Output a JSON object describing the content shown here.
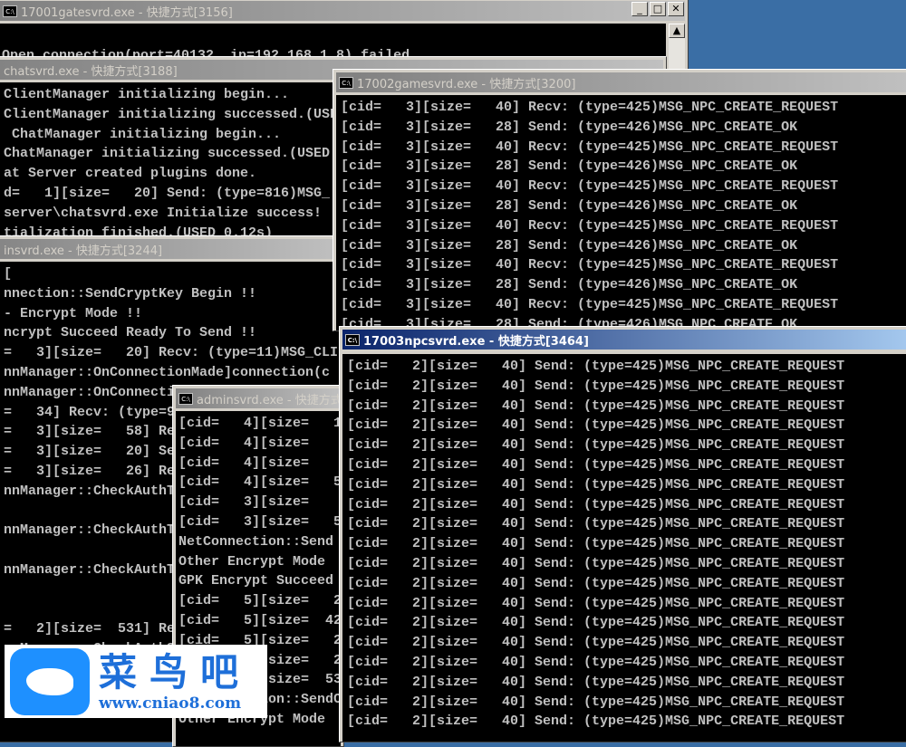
{
  "windows": {
    "gate": {
      "title": "17001gatesvrd.exe - 快捷方式[3156]",
      "lines": [
        "",
        "Open connection(port=40132, ip=192.168.1.8) failed"
      ]
    },
    "chat": {
      "title": "chatsvrd.exe - 快捷方式[3188]",
      "lines": [
        "ClientManager initializing begin...",
        "ClientManager initializing successed.(USED",
        " ChatManager initializing begin...",
        "ChatManager initializing successed.(USED",
        "at Server created plugins done.",
        "d=   1][size=   20] Send: (type=816)MSG_",
        "server\\chatsvrd.exe Initialize success!",
        "tialization finished.(USED 0.12s)"
      ]
    },
    "adminBig": {
      "title": "insvrd.exe - 快捷方式[3244]",
      "lines": [
        "[",
        "nnection::SendCryptKey Begin !!",
        "- Encrypt Mode !!",
        "ncrypt Succeed Ready To Send !!",
        "=   3][size=   20] Recv: (type=11)MSG_CLI",
        "nnManager::OnConnectionMade]connection(c",
        "nnManager::OnConnecti",
        "=   34] Recv: (type=9",
        "=   3][size=   58] Rec",
        "=   3][size=   20] Sen",
        "=   3][size=   26] Rec",
        "nnManager::CheckAuthT",
        "",
        "nnManager::CheckAuthT",
        "",
        "nnManager::CheckAuthT",
        "",
        "",
        "=   2][size=  531] Rec",
        "nnManager::CheckAuthS"
      ]
    },
    "game": {
      "title": "17002gamesvrd.exe - 快捷方式[3200]",
      "lines": [
        "[cid=   3][size=   40] Recv: (type=425)MSG_NPC_CREATE_REQUEST",
        "[cid=   3][size=   28] Send: (type=426)MSG_NPC_CREATE_OK",
        "[cid=   3][size=   40] Recv: (type=425)MSG_NPC_CREATE_REQUEST",
        "[cid=   3][size=   28] Send: (type=426)MSG_NPC_CREATE_OK",
        "[cid=   3][size=   40] Recv: (type=425)MSG_NPC_CREATE_REQUEST",
        "[cid=   3][size=   28] Send: (type=426)MSG_NPC_CREATE_OK",
        "[cid=   3][size=   40] Recv: (type=425)MSG_NPC_CREATE_REQUEST",
        "[cid=   3][size=   28] Send: (type=426)MSG_NPC_CREATE_OK",
        "[cid=   3][size=   40] Recv: (type=425)MSG_NPC_CREATE_REQUEST",
        "[cid=   3][size=   28] Send: (type=426)MSG_NPC_CREATE_OK",
        "[cid=   3][size=   40] Recv: (type=425)MSG_NPC_CREATE_REQUEST",
        "[cid=   3][size=   28] Send: (type=426)MSG_NPC_CREATE_OK"
      ]
    },
    "adminSmall": {
      "title": "adminsvrd.exe - 快捷方式",
      "lines": [
        "[cid=   4][size=   1",
        "[cid=   4][size=",
        "[cid=   4][size=",
        "[cid=   4][size=   5",
        "[cid=   3][size=",
        "[cid=   3][size=   5",
        "NetConnection::Send",
        "Other Encrypt Mode",
        "GPK Encrypt Succeed",
        "[cid=   5][size=   2",
        "[cid=   5][size=  42",
        "[cid=   5][size=   2",
        "[cid=   5][size=   2",
        "[cid=   5][size=  53",
        "NetConnection::SendC",
        "Other Encrypt Mode"
      ]
    },
    "npc": {
      "title": "17003npcsvrd.exe - 快捷方式[3464]",
      "lines": [
        "[cid=   2][size=   40] Send: (type=425)MSG_NPC_CREATE_REQUEST",
        "[cid=   2][size=   40] Send: (type=425)MSG_NPC_CREATE_REQUEST",
        "[cid=   2][size=   40] Send: (type=425)MSG_NPC_CREATE_REQUEST",
        "[cid=   2][size=   40] Send: (type=425)MSG_NPC_CREATE_REQUEST",
        "[cid=   2][size=   40] Send: (type=425)MSG_NPC_CREATE_REQUEST",
        "[cid=   2][size=   40] Send: (type=425)MSG_NPC_CREATE_REQUEST",
        "[cid=   2][size=   40] Send: (type=425)MSG_NPC_CREATE_REQUEST",
        "[cid=   2][size=   40] Send: (type=425)MSG_NPC_CREATE_REQUEST",
        "[cid=   2][size=   40] Send: (type=425)MSG_NPC_CREATE_REQUEST",
        "[cid=   2][size=   40] Send: (type=425)MSG_NPC_CREATE_REQUEST",
        "[cid=   2][size=   40] Send: (type=425)MSG_NPC_CREATE_REQUEST",
        "[cid=   2][size=   40] Send: (type=425)MSG_NPC_CREATE_REQUEST",
        "[cid=   2][size=   40] Send: (type=425)MSG_NPC_CREATE_REQUEST",
        "[cid=   2][size=   40] Send: (type=425)MSG_NPC_CREATE_REQUEST",
        "[cid=   2][size=   40] Send: (type=425)MSG_NPC_CREATE_REQUEST",
        "[cid=   2][size=   40] Send: (type=425)MSG_NPC_CREATE_REQUEST",
        "[cid=   2][size=   40] Send: (type=425)MSG_NPC_CREATE_REQUEST",
        "[cid=   2][size=   40] Send: (type=425)MSG_NPC_CREATE_REQUEST",
        "[cid=   2][size=   40] Send: (type=425)MSG_NPC_CREATE_REQUEST"
      ]
    }
  },
  "icon_label": "C:\\",
  "buttons": {
    "minimize": "_",
    "maximize": "□",
    "close": "✕",
    "scroll_up": "▲"
  },
  "watermark": {
    "name": "菜鸟吧",
    "url": "www.cniao8.com"
  },
  "colors": {
    "desktop": "#3a6ea5",
    "console_bg": "#000000",
    "console_fg": "#c0c0c0",
    "active_title": "#0a246a"
  }
}
